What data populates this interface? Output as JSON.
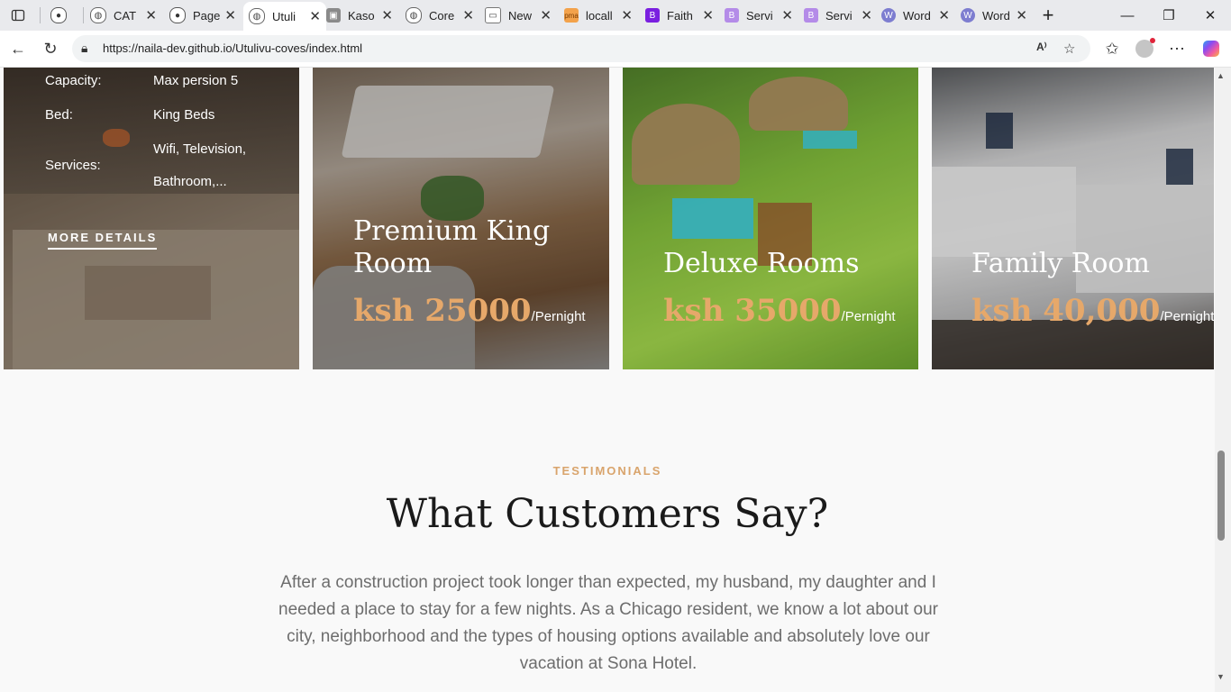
{
  "tabs": [
    {
      "label": "",
      "icon": "github-icon"
    },
    {
      "label": "CAT",
      "icon": "globe-icon"
    },
    {
      "label": "Page",
      "icon": "github-icon"
    },
    {
      "label": "Utuli",
      "icon": "globe-icon"
    },
    {
      "label": "Kaso",
      "icon": "image-icon"
    },
    {
      "label": "Core",
      "icon": "globe-icon"
    },
    {
      "label": "New",
      "icon": "newtab-icon"
    },
    {
      "label": "locall",
      "icon": "pma-icon"
    },
    {
      "label": "Faith",
      "icon": "bootstrap-icon"
    },
    {
      "label": "Servi",
      "icon": "bootstrap-icon"
    },
    {
      "label": "Servi",
      "icon": "bootstrap-icon"
    },
    {
      "label": "Word",
      "icon": "wordpress-icon"
    },
    {
      "label": "Word",
      "icon": "wordpress-icon"
    }
  ],
  "address": {
    "url": "https://naila-dev.github.io/Utulivu-coves/index.html"
  },
  "rooms": {
    "first": {
      "capacity_label": "Capacity:",
      "capacity_value": "Max persion 5",
      "bed_label": "Bed:",
      "bed_value": "King Beds",
      "services_label": "Services:",
      "services_value_1": "Wifi, Television,",
      "services_value_2": "Bathroom,...",
      "more_label": "MORE DETAILS"
    },
    "premium": {
      "title_1": "Premium King",
      "title_2": "Room",
      "price": "ksh 25000",
      "per": "/Pernight"
    },
    "deluxe": {
      "title": "Deluxe Rooms",
      "price": "ksh 35000",
      "per": "/Pernight"
    },
    "family": {
      "title": "Family Room",
      "price": "ksh 40,000",
      "per": "/Pernight"
    }
  },
  "testimonials": {
    "eyebrow": "TESTIMONIALS",
    "heading": "What Customers Say?",
    "quote": "After a construction project took longer than expected, my husband, my daughter and I needed a place to stay for a few nights. As a Chicago resident, we know a lot about our city, neighborhood and the types of housing options available and absolutely love our vacation at Sona Hotel."
  },
  "colors": {
    "accent": "#e6a86a",
    "eyebrow": "#d9a46c"
  }
}
